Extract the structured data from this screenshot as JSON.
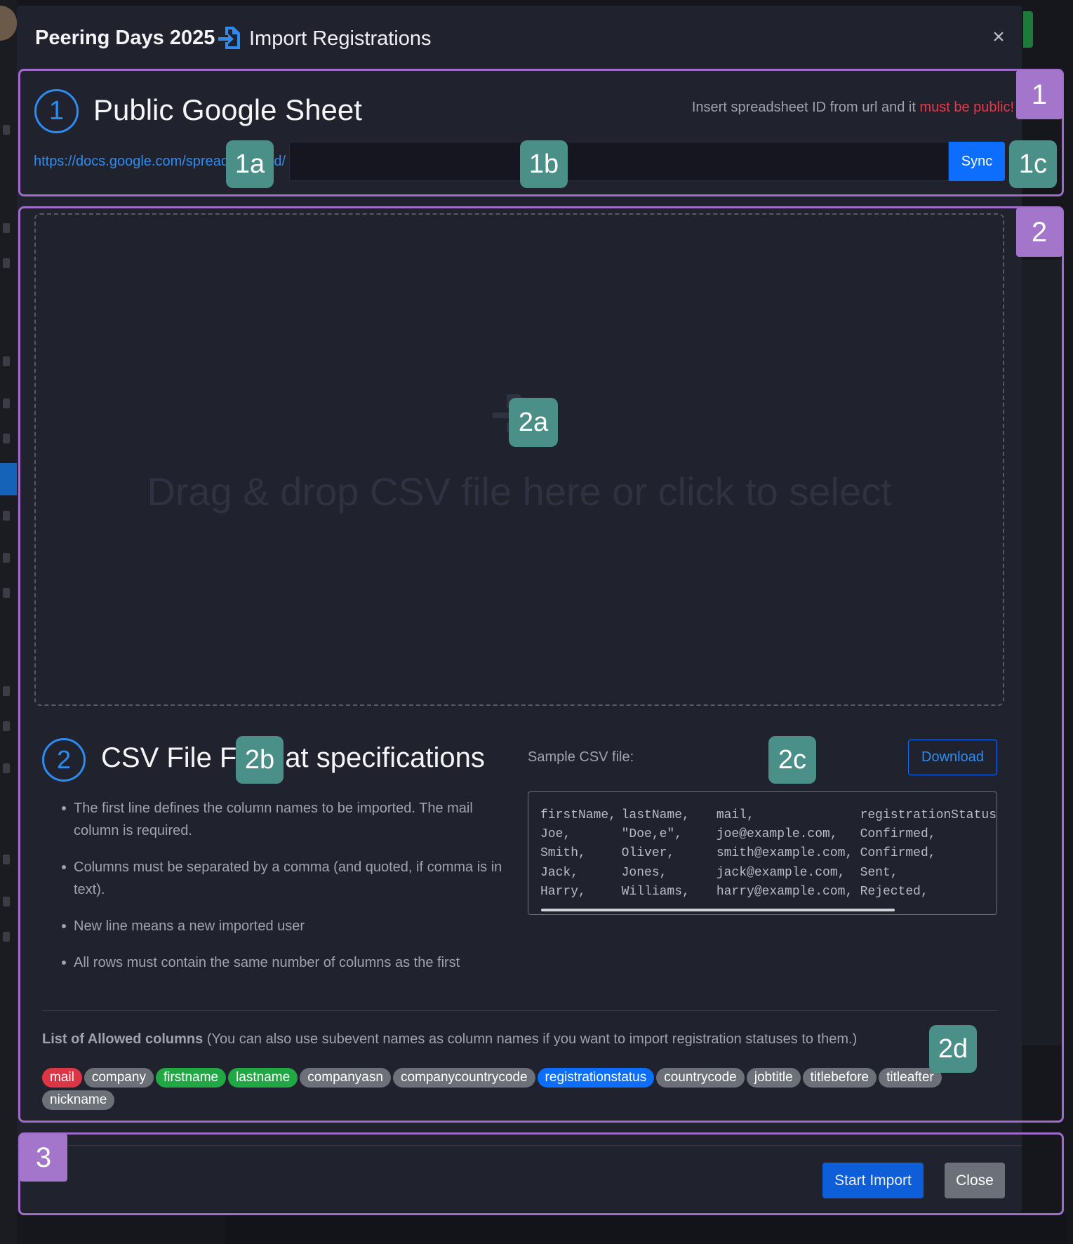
{
  "header": {
    "event_name": "Peering Days 2025",
    "title": "Import Registrations",
    "close_icon": "×"
  },
  "section1": {
    "step": "1",
    "title": "Public Google Sheet",
    "hint_prefix": "Insert spreadsheet ID from url and it",
    "hint_warning": "must be public!",
    "url_prefix": "https://docs.google.com/spreadsheets/d/",
    "input_value": "",
    "sync_label": "Sync"
  },
  "dropzone": {
    "text": "Drag & drop CSV file here or click to select",
    "icon": "file-import-icon"
  },
  "specs": {
    "step": "2",
    "title": "CSV File Format specifications",
    "rules": [
      "The first line defines the column names to be imported. The mail column is required.",
      "Columns must be separated by a comma (and quoted, if comma is in text).",
      "New line means a new imported user",
      "All rows must contain the same number of columns as the first"
    ],
    "sample_label": "Sample CSV file:",
    "download_label": "Download",
    "sample_rows": [
      [
        "firstName,",
        "lastName,",
        "mail,",
        "registrationStatus"
      ],
      [
        "Joe,",
        "\"Doe,e\",",
        "joe@example.com,",
        "Confirmed,"
      ],
      [
        "Smith,",
        "Oliver,",
        "smith@example.com,",
        "Confirmed,"
      ],
      [
        "Jack,",
        "Jones,",
        "jack@example.com,",
        "Sent,"
      ],
      [
        "Harry,",
        "Williams,",
        "harry@example.com,",
        "Rejected,"
      ]
    ],
    "allowed_title": "List of Allowed columns",
    "allowed_note": " (You can also use subevent names as column names if you want to import registration statuses to them.)",
    "columns": [
      {
        "label": "mail",
        "kind": "req"
      },
      {
        "label": "company",
        "kind": "default"
      },
      {
        "label": "firstname",
        "kind": "name"
      },
      {
        "label": "lastname",
        "kind": "name"
      },
      {
        "label": "companyasn",
        "kind": "default"
      },
      {
        "label": "companycountrycode",
        "kind": "default"
      },
      {
        "label": "registrationstatus",
        "kind": "status"
      },
      {
        "label": "countrycode",
        "kind": "default"
      },
      {
        "label": "jobtitle",
        "kind": "default"
      },
      {
        "label": "titlebefore",
        "kind": "default"
      },
      {
        "label": "titleafter",
        "kind": "default"
      },
      {
        "label": "nickname",
        "kind": "default"
      }
    ]
  },
  "footer": {
    "start_label": "Start Import",
    "close_label": "Close"
  },
  "annotations": {
    "s1": "1",
    "s1a": "1a",
    "s1b": "1b",
    "s1c": "1c",
    "s2": "2",
    "s2a": "2a",
    "s2b": "2b",
    "s2c": "2c",
    "s2d": "2d",
    "s3": "3"
  },
  "colors": {
    "modal_bg": "#20222d",
    "accent": "#0d6efd",
    "warning": "#e8394a",
    "annotation_purple": "#a375cb",
    "annotation_teal": "#4a8f88"
  }
}
